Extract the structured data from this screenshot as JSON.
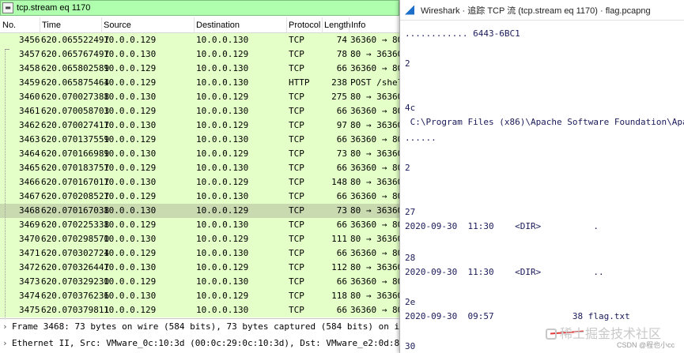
{
  "filter": {
    "value": "tcp.stream eq 1170"
  },
  "columns": [
    "No.",
    "Time",
    "Source",
    "Destination",
    "Protocol",
    "Length",
    "Info"
  ],
  "packets": [
    {
      "no": "3456",
      "time": "620.065522497",
      "src": "10.0.0.129",
      "dst": "10.0.0.130",
      "proto": "TCP",
      "len": "74",
      "info": "36360 → 80"
    },
    {
      "no": "3457",
      "time": "620.065767497",
      "src": "10.0.0.130",
      "dst": "10.0.0.129",
      "proto": "TCP",
      "len": "78",
      "info": "80 → 36360"
    },
    {
      "no": "3458",
      "time": "620.065802589",
      "src": "10.0.0.129",
      "dst": "10.0.0.130",
      "proto": "TCP",
      "len": "66",
      "info": "36360 → 80"
    },
    {
      "no": "3459",
      "time": "620.065875464",
      "src": "10.0.0.129",
      "dst": "10.0.0.130",
      "proto": "HTTP",
      "len": "238",
      "info": "POST /shel"
    },
    {
      "no": "3460",
      "time": "620.070027388",
      "src": "10.0.0.130",
      "dst": "10.0.0.129",
      "proto": "TCP",
      "len": "275",
      "info": "80 → 36360"
    },
    {
      "no": "3461",
      "time": "620.070058703",
      "src": "10.0.0.129",
      "dst": "10.0.0.130",
      "proto": "TCP",
      "len": "66",
      "info": "36360 → 80"
    },
    {
      "no": "3462",
      "time": "620.070027417",
      "src": "10.0.0.130",
      "dst": "10.0.0.129",
      "proto": "TCP",
      "len": "97",
      "info": "80 → 36360"
    },
    {
      "no": "3463",
      "time": "620.070137559",
      "src": "10.0.0.129",
      "dst": "10.0.0.130",
      "proto": "TCP",
      "len": "66",
      "info": "36360 → 80"
    },
    {
      "no": "3464",
      "time": "620.070166989",
      "src": "10.0.0.130",
      "dst": "10.0.0.129",
      "proto": "TCP",
      "len": "73",
      "info": "80 → 36360"
    },
    {
      "no": "3465",
      "time": "620.070183757",
      "src": "10.0.0.129",
      "dst": "10.0.0.130",
      "proto": "TCP",
      "len": "66",
      "info": "36360 → 80"
    },
    {
      "no": "3466",
      "time": "620.070167017",
      "src": "10.0.0.130",
      "dst": "10.0.0.129",
      "proto": "TCP",
      "len": "148",
      "info": "80 → 36360"
    },
    {
      "no": "3467",
      "time": "620.070208527",
      "src": "10.0.0.129",
      "dst": "10.0.0.130",
      "proto": "TCP",
      "len": "66",
      "info": "36360 → 80"
    },
    {
      "no": "3468",
      "time": "620.070167038",
      "src": "10.0.0.130",
      "dst": "10.0.0.129",
      "proto": "TCP",
      "len": "73",
      "info": "80 → 36360"
    },
    {
      "no": "3469",
      "time": "620.070225338",
      "src": "10.0.0.129",
      "dst": "10.0.0.130",
      "proto": "TCP",
      "len": "66",
      "info": "36360 → 80"
    },
    {
      "no": "3470",
      "time": "620.070298570",
      "src": "10.0.0.130",
      "dst": "10.0.0.129",
      "proto": "TCP",
      "len": "111",
      "info": "80 → 36360"
    },
    {
      "no": "3471",
      "time": "620.070302724",
      "src": "10.0.0.129",
      "dst": "10.0.0.130",
      "proto": "TCP",
      "len": "66",
      "info": "36360 → 80"
    },
    {
      "no": "3472",
      "time": "620.070326447",
      "src": "10.0.0.130",
      "dst": "10.0.0.129",
      "proto": "TCP",
      "len": "112",
      "info": "80 → 36360"
    },
    {
      "no": "3473",
      "time": "620.070329230",
      "src": "10.0.0.129",
      "dst": "10.0.0.130",
      "proto": "TCP",
      "len": "66",
      "info": "36360 → 80"
    },
    {
      "no": "3474",
      "time": "620.070376236",
      "src": "10.0.0.130",
      "dst": "10.0.0.129",
      "proto": "TCP",
      "len": "118",
      "info": "80 → 36360"
    },
    {
      "no": "3475",
      "time": "620.070379811",
      "src": "10.0.0.129",
      "dst": "10.0.0.130",
      "proto": "TCP",
      "len": "66",
      "info": "36360 → 80"
    }
  ],
  "selected_no": "3468",
  "details": [
    "Frame 3468: 73 bytes on wire (584 bits), 73 bytes captured (584 bits) on interface eth0",
    "Ethernet II, Src: VMware_0c:10:3d (00:0c:29:0c:10:3d), Dst: VMware_e2:0d:83 (00:0c:29:e"
  ],
  "follow": {
    "title": "Wireshark · 追踪 TCP 流 (tcp.stream eq 1170) · flag.pcapng",
    "lines": [
      "............ 6443-6BC1",
      "2",
      "4c",
      " C:\\Program Files (x86)\\Apache Software Foundation\\Apache2.2\\htdocs",
      "......",
      "2",
      "27",
      "2020-09-30  11:30    <DIR>          .",
      "28",
      "2020-09-30  11:30    <DIR>          ..",
      "2e",
      "2020-09-30  09:57               38 flag.txt",
      "30"
    ]
  },
  "watermark": {
    "text": "稀土掘金技术社区",
    "credit": "CSDN @程也小cc"
  },
  "colors": {
    "filter_bg": "#afffaf",
    "row_bg": "#e4ffc7",
    "row_selected": "#c9d9b0"
  }
}
